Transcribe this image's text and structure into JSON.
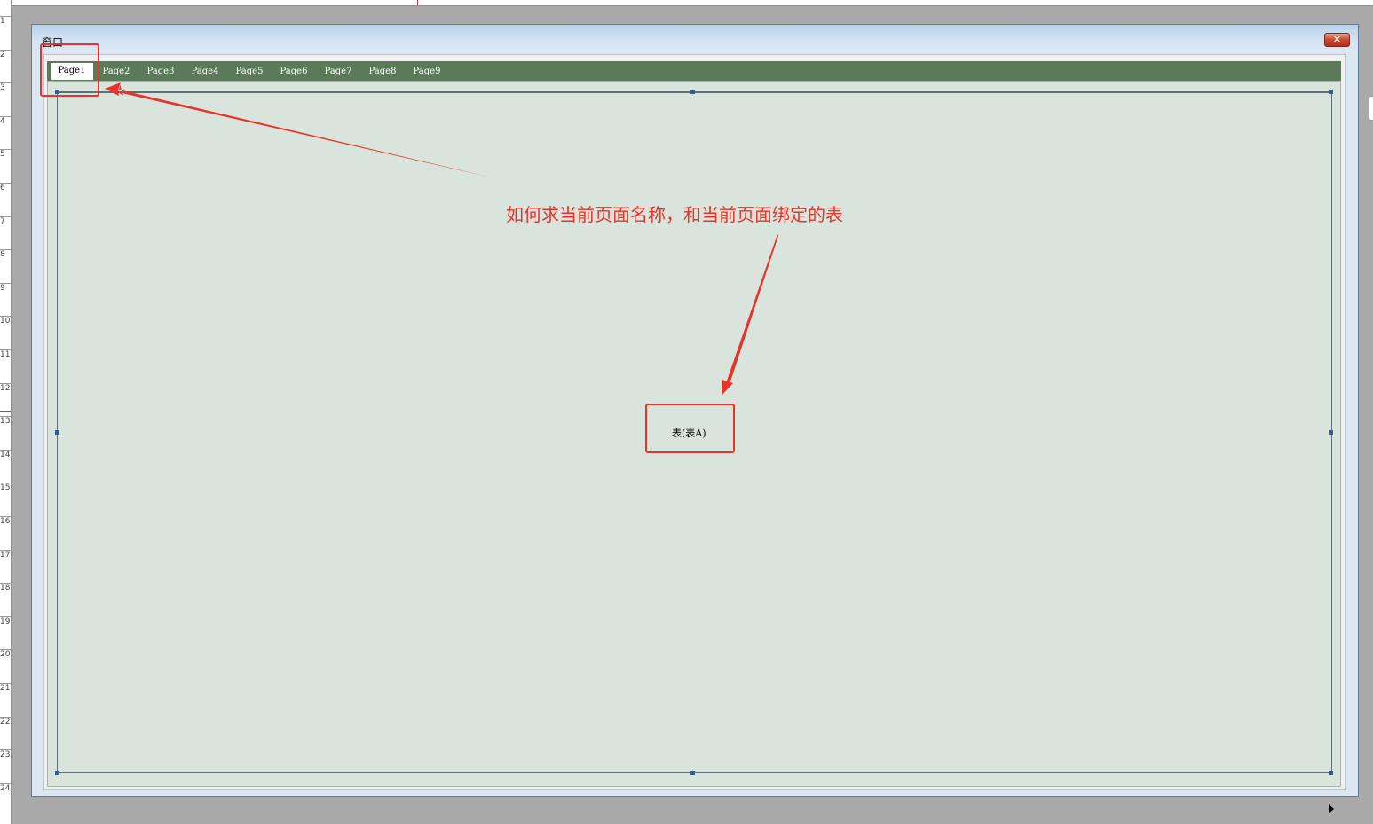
{
  "window": {
    "title": "窗口",
    "close_glyph": "✕"
  },
  "tabs": [
    "Page1",
    "Page2",
    "Page3",
    "Page4",
    "Page5",
    "Page6",
    "Page7",
    "Page8",
    "Page9"
  ],
  "active_tab": "Page1",
  "table_control": {
    "label": "表(表A)"
  },
  "annotation": {
    "text": "如何求当前页面名称，和当前页面绑定的表",
    "color": "#e8322a"
  },
  "ruler": {
    "labels": [
      "1",
      "2",
      "3",
      "4",
      "5",
      "6",
      "7",
      "8",
      "9",
      "10",
      "11",
      "12",
      "13",
      "14",
      "15",
      "16",
      "17",
      "18",
      "19",
      "20",
      "21",
      "22",
      "23",
      "24"
    ]
  },
  "colors": {
    "tab_bar": "#5a7a58",
    "page_background": "#d9e5dc",
    "selection_handle": "#2f5f96"
  }
}
